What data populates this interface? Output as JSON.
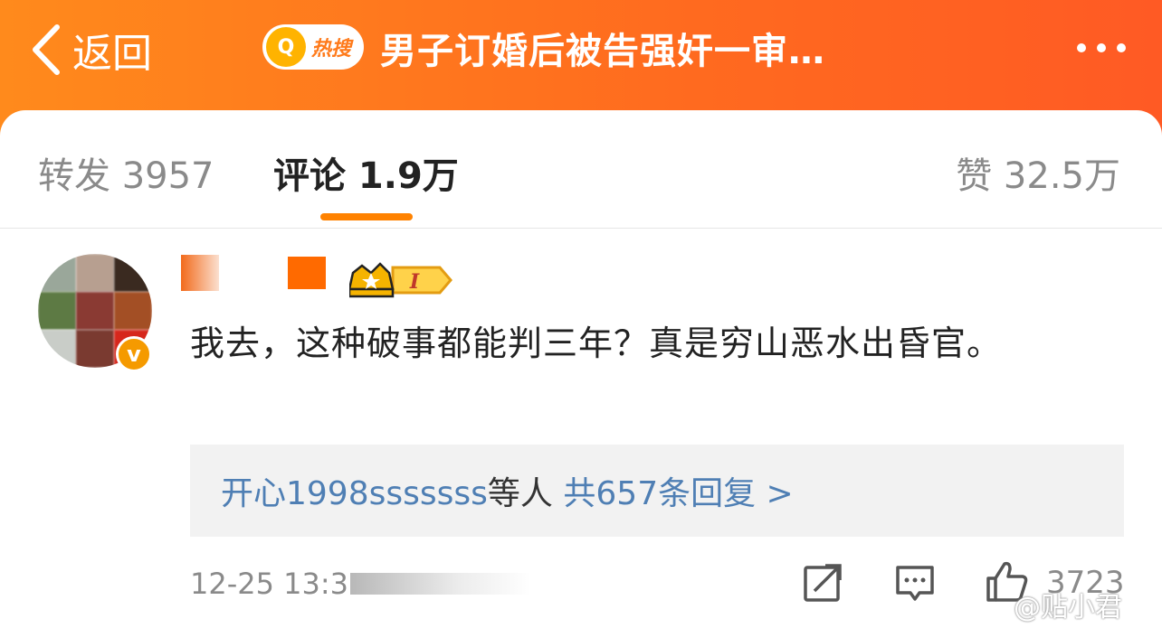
{
  "header": {
    "back_label": "返回",
    "hot_search_label": "热搜",
    "title": "男子订婚后被告强奸一审…",
    "more_icon": "more-dots-icon"
  },
  "tabs": {
    "repost": "转发 3957",
    "comment": "评论 1.9万",
    "like": "赞 32.5万",
    "active": "comment"
  },
  "comment": {
    "text": "我去，这种破事都能判三年？真是穷山恶水出昏官。",
    "level_badge": "I",
    "verified_icon": "v-verified-icon"
  },
  "replies": {
    "names": "开心1998sssssss",
    "middle": "等人",
    "count_text": "共657条回复 >"
  },
  "footer": {
    "time": "12-25 13:3",
    "like_count": "3723"
  },
  "watermark": "@贴小君",
  "colors": {
    "header_orange": "#ff7a1f",
    "accent": "#ff8200",
    "link_blue": "#4f7fb4"
  }
}
